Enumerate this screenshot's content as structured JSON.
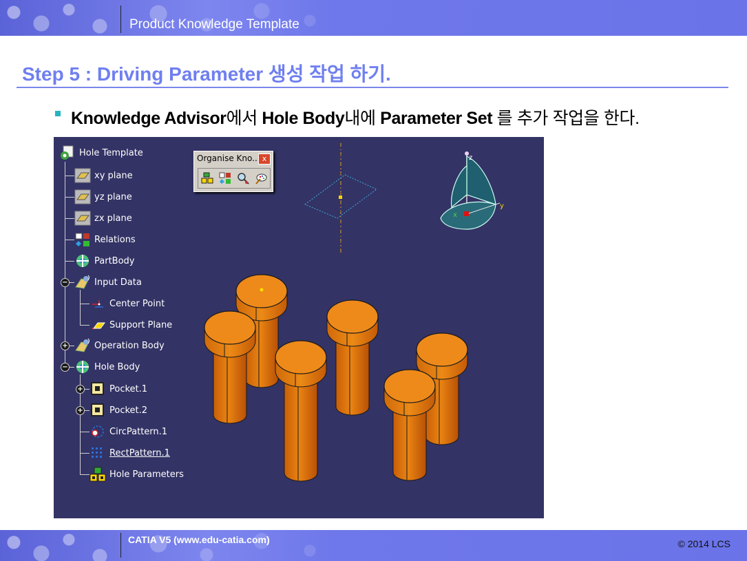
{
  "header": {
    "title": "Product Knowledge Template"
  },
  "heading": "Step 5 : Driving Parameter 생성 작업 하기.",
  "bullet": {
    "b1": "Knowledge Advisor",
    "t1": "에서 ",
    "b2": "Hole Body",
    "t2": "내에 ",
    "b3": "Parameter Set",
    "t3": " 를 추가 작업을 한다."
  },
  "tree": {
    "root": "Hole Template",
    "xy": "xy plane",
    "yz": "yz plane",
    "zx": "zx plane",
    "relations": "Relations",
    "partbody": "PartBody",
    "input_data": "Input Data",
    "center_point": "Center Point",
    "support_plane": "Support Plane",
    "operation_body": "Operation Body",
    "hole_body": "Hole Body",
    "pocket1": "Pocket.1",
    "pocket2": "Pocket.2",
    "circpattern": "CircPattern.1",
    "rectpattern": "RectPattern.1",
    "hole_parameters": "Hole Parameters"
  },
  "toolbar": {
    "title": "Organise Kno...",
    "close": "x"
  },
  "compass": {
    "x": "x",
    "y": "y",
    "z": "z"
  },
  "footer": {
    "left": "CATIA V5 (www.edu-catia.com)",
    "right": "© 2014 LCS"
  },
  "colors": {
    "accent": "#6f7ff0",
    "viewport_bg": "#333366",
    "cylinder": "#e27a12"
  },
  "icons": [
    "part-icon",
    "plane-icon",
    "relations-icon",
    "partbody-icon",
    "geometric-set-icon",
    "point-icon",
    "plane-feature-icon",
    "body-icon",
    "pocket-icon",
    "circ-pattern-icon",
    "rect-pattern-icon",
    "parameter-set-icon",
    "close-icon"
  ]
}
